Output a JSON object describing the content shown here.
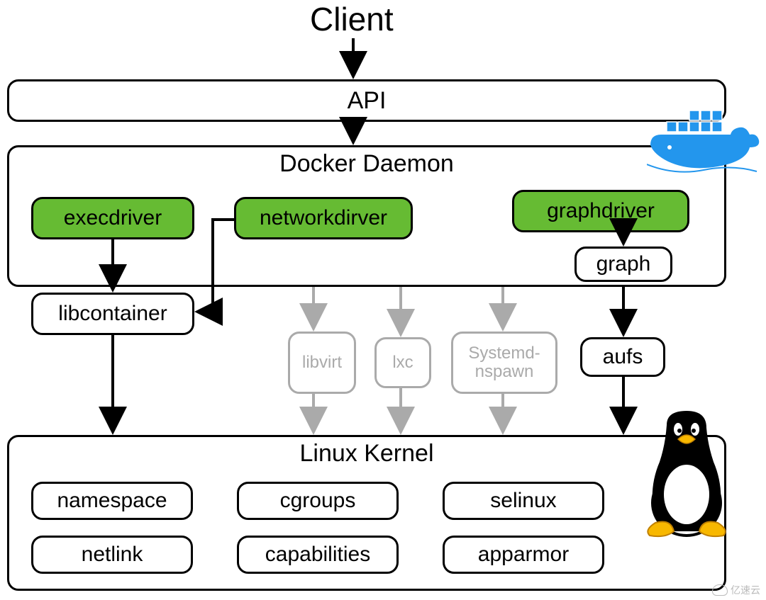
{
  "colors": {
    "green": "#66bb33",
    "faded": "#aaaaaa",
    "docker_blue": "#2396ed"
  },
  "client": "Client",
  "api": "API",
  "daemon_title": "Docker Daemon",
  "drivers": {
    "exec": "execdriver",
    "network": "networkdirver",
    "graph": "graphdriver"
  },
  "graph": "graph",
  "libcontainer": "libcontainer",
  "middle": {
    "libvirt": "libvirt",
    "lxc": "lxc",
    "systemd": "Systemd-nspawn"
  },
  "aufs": "aufs",
  "kernel_title": "Linux Kernel",
  "kernel": {
    "namespace": "namespace",
    "cgroups": "cgroups",
    "selinux": "selinux",
    "netlink": "netlink",
    "capabilities": "capabilities",
    "apparmor": "apparmor"
  },
  "watermark": "亿速云"
}
